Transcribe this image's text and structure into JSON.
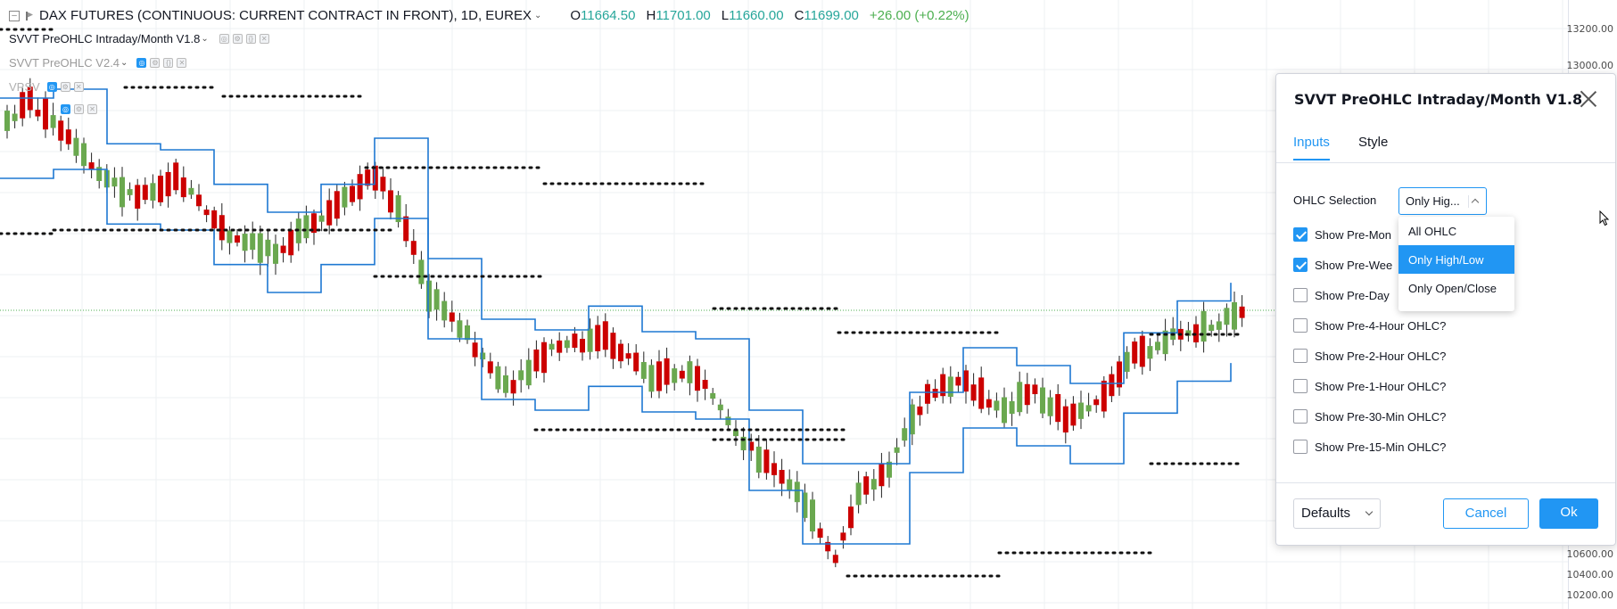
{
  "legend": {
    "symbol": "DAX FUTURES (CONTINUOUS: CURRENT CONTRACT IN FRONT), 1D, EUREX",
    "ohlc": {
      "o_label": "O",
      "o": "11664.50",
      "h_label": "H",
      "h": "11701.00",
      "l_label": "L",
      "l": "11660.00",
      "c_label": "C",
      "c": "11699.00",
      "change": "+26.00 (+0.22%)"
    }
  },
  "indicators": [
    {
      "name": "SVVT PreOHLC Intraday/Month V1.8"
    },
    {
      "name": "SVVT PreOHLC V2.4"
    },
    {
      "name": "VPSV"
    }
  ],
  "price_axis": {
    "labels": [
      "13200.00",
      "13000.00",
      "10600.00",
      "10400.00",
      "10200.00"
    ]
  },
  "dialog": {
    "title": "SVVT PreOHLC Intraday/Month V1.8",
    "tabs": [
      "Inputs",
      "Style"
    ],
    "active_tab": "Inputs",
    "ohlc_selection_label": "OHLC Selection",
    "ohlc_selection_value": "Only Hig...",
    "dropdown_options": [
      "All OHLC",
      "Only High/Low",
      "Only Open/Close"
    ],
    "dropdown_selected": "Only High/Low",
    "checkboxes": [
      {
        "label": "Show Pre-Mon",
        "checked": true
      },
      {
        "label": "Show Pre-Wee",
        "checked": true
      },
      {
        "label": "Show Pre-Day",
        "checked": false
      },
      {
        "label": "Show Pre-4-Hour OHLC?",
        "checked": false
      },
      {
        "label": "Show Pre-2-Hour OHLC?",
        "checked": false
      },
      {
        "label": "Show Pre-1-Hour OHLC?",
        "checked": false
      },
      {
        "label": "Show Pre-30-Min OHLC?",
        "checked": false
      },
      {
        "label": "Show Pre-15-Min OHLC?",
        "checked": false
      }
    ],
    "defaults_label": "Defaults",
    "cancel_label": "Cancel",
    "ok_label": "Ok"
  },
  "colors": {
    "up": "#6aa84f",
    "down": "#cc0000",
    "band": "#1e78d2",
    "accent": "#2196f3"
  }
}
